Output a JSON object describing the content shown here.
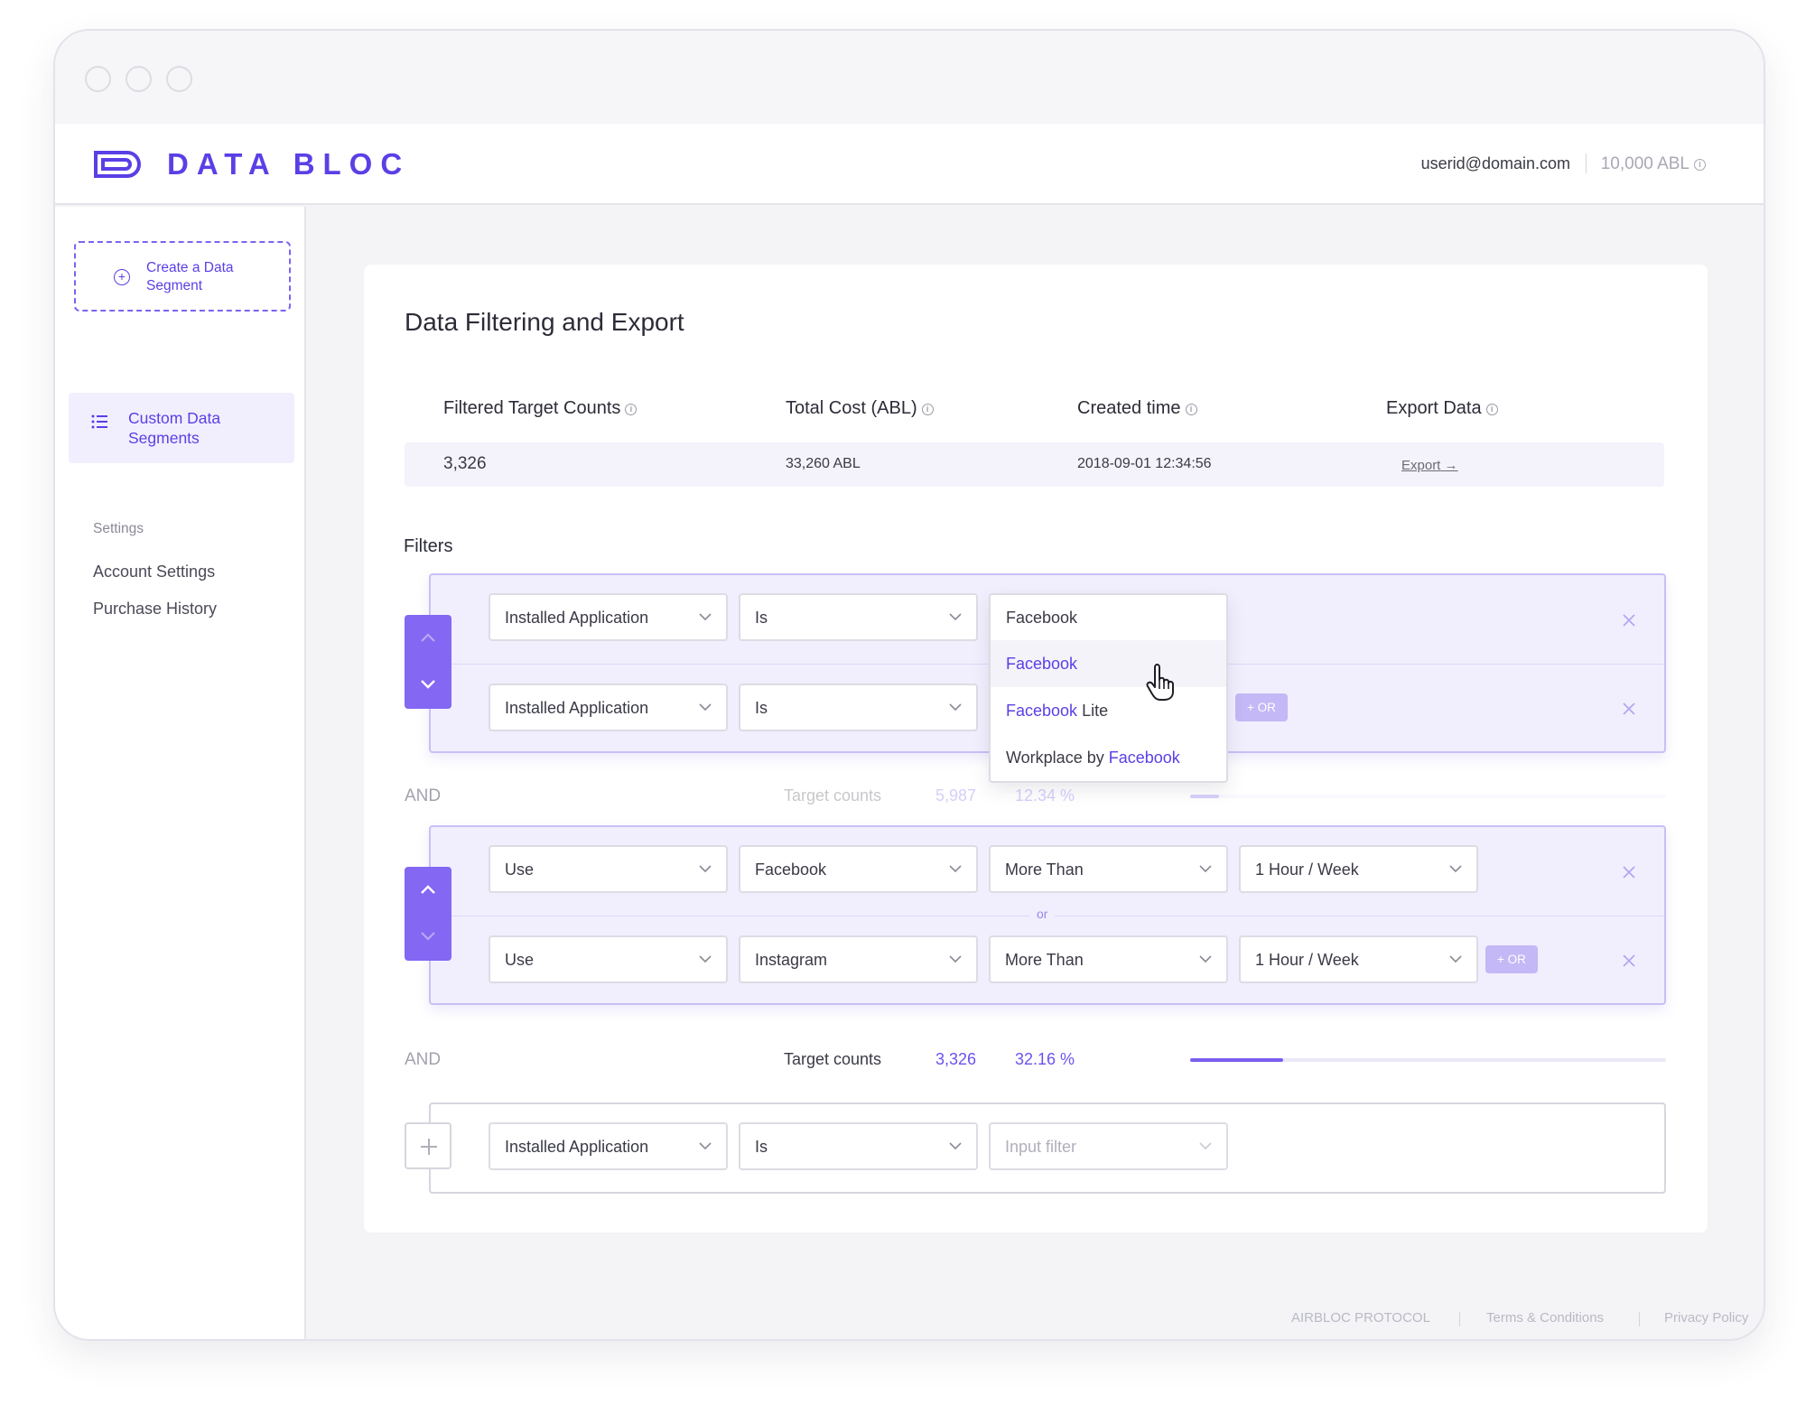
{
  "header": {
    "logo_text": "DATA BLOC",
    "user_email": "userid@domain.com",
    "balance": "10,000 ABL"
  },
  "sidebar": {
    "create_label": "Create a Data Segment",
    "active_item": "Custom Data Segments",
    "settings_heading": "Settings",
    "links": [
      "Account Settings",
      "Purchase History"
    ]
  },
  "main": {
    "title": "Data Filtering and Export",
    "columns": [
      "Filtered Target Counts",
      "Total Cost (ABL)",
      "Created time",
      "Export Data"
    ],
    "values": {
      "target_counts": "3,326",
      "total_cost": "33,260 ABL",
      "created_time": "2018-09-01 12:34:56",
      "export": "Export"
    },
    "filters_label": "Filters",
    "or_label": "+ OR",
    "or_divider": "or",
    "and_label": "AND",
    "target_counts_label": "Target counts"
  },
  "groups": [
    {
      "rows": [
        {
          "field": "Installed Application",
          "op": "Is",
          "value": "Facebook"
        },
        {
          "field": "Installed Application",
          "op": "Is",
          "value": ""
        }
      ],
      "summary": {
        "count": "5,987",
        "percent": "12.34 %",
        "progress": 0.06
      }
    },
    {
      "rows": [
        {
          "action": "Use",
          "app": "Facebook",
          "compare": "More Than",
          "amount": "1 Hour / Week"
        },
        {
          "action": "Use",
          "app": "Instagram",
          "compare": "More Than",
          "amount": "1 Hour / Week"
        }
      ],
      "summary": {
        "count": "3,326",
        "percent": "32.16 %",
        "progress": 0.195
      }
    },
    {
      "rows": [
        {
          "field": "Installed Application",
          "op": "Is",
          "value_placeholder": "Input filter"
        }
      ]
    }
  ],
  "dropdown": {
    "current": "Facebook",
    "options": [
      {
        "match": "Facebook",
        "rest": "",
        "prefix": ""
      },
      {
        "match": "Facebook",
        "rest": " Lite",
        "prefix": ""
      },
      {
        "match": "Facebook",
        "rest": "",
        "prefix": "Workplace by "
      }
    ]
  },
  "footer": {
    "links": [
      "AIRBLOC PROTOCOL",
      "Terms & Conditions",
      "Privacy Policy"
    ]
  },
  "colors": {
    "accent": "#5b3fe6",
    "accent_button": "#8467f2",
    "group_bg": "#f1effd",
    "progress": "#7a5ef0"
  },
  "icons": [
    "info-icon",
    "plus-circle-icon",
    "list-icon",
    "chevron-down-icon",
    "chevron-up-icon",
    "close-icon",
    "arrow-right-icon",
    "plus-icon",
    "hand-cursor-icon"
  ]
}
